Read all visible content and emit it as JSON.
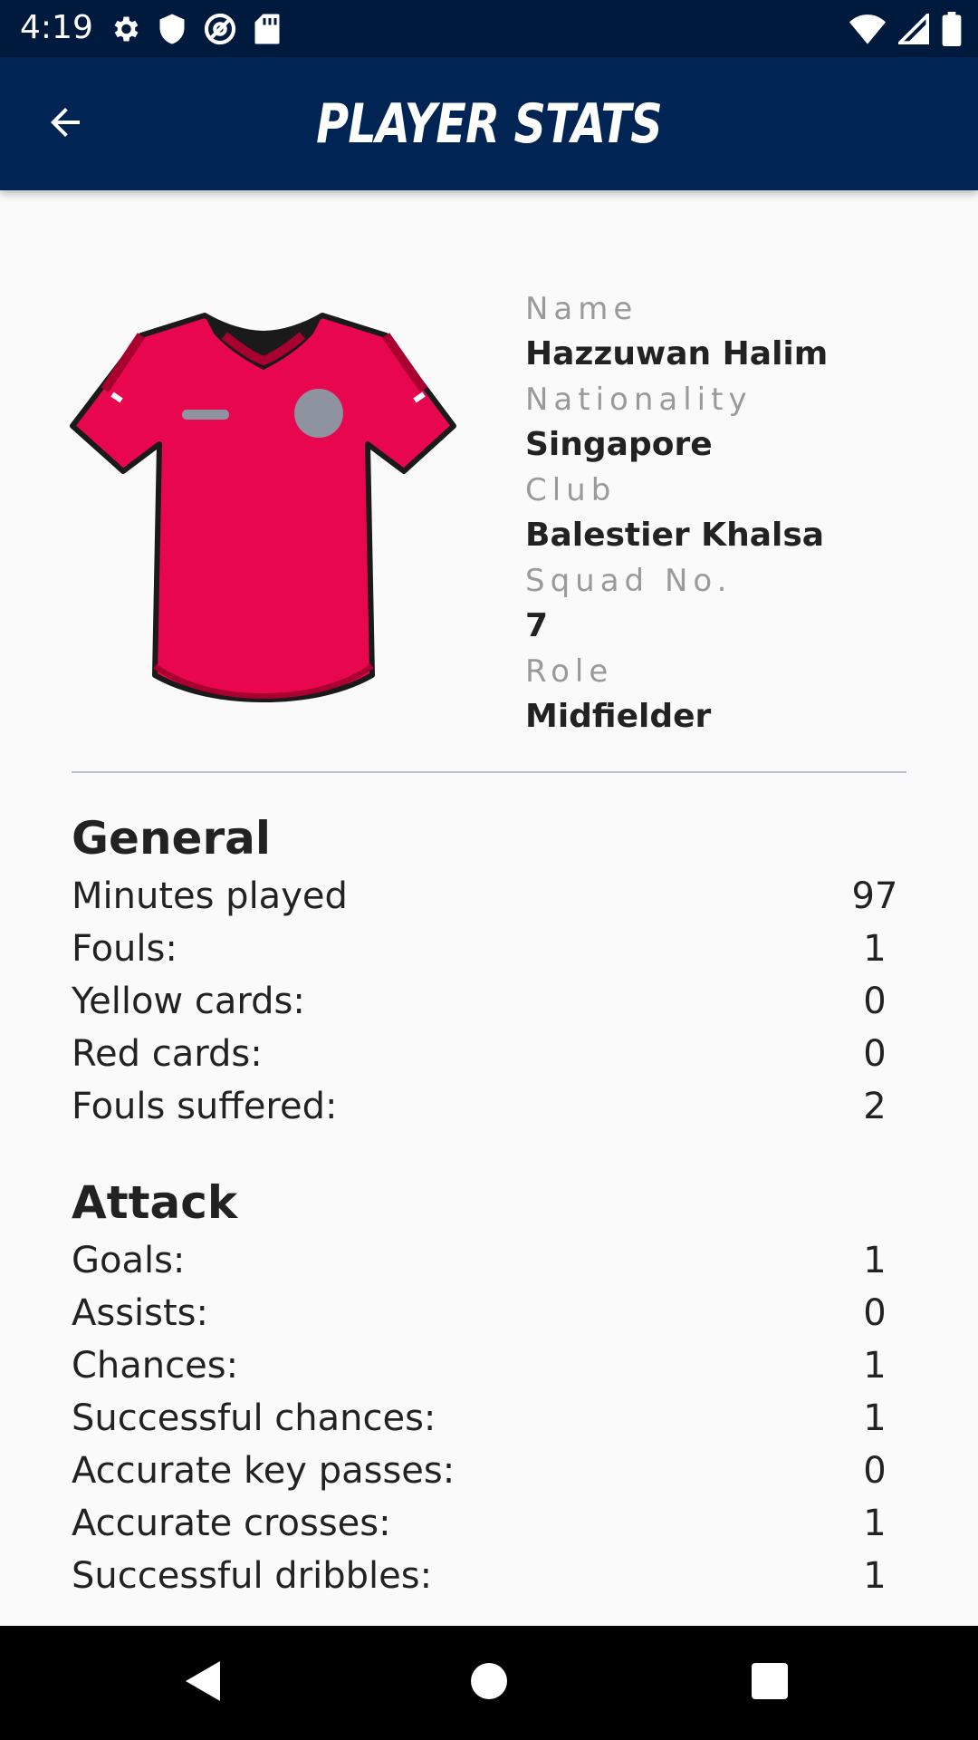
{
  "status_bar": {
    "time": "4:19",
    "left_icons": [
      "gear-icon",
      "shield-icon",
      "at-sign-icon",
      "sd-card-icon"
    ],
    "right_icons": [
      "wifi-icon",
      "signal-icon",
      "battery-icon"
    ]
  },
  "app_bar": {
    "title": "PLAYER STATS",
    "back_icon": "arrow-left-icon"
  },
  "player": {
    "jersey_colors": {
      "primary": "#e8064f",
      "collar": "#1a1a1a"
    },
    "fields": [
      {
        "label": "Name",
        "value": "Hazzuwan Halim"
      },
      {
        "label": "Nationality",
        "value": "Singapore"
      },
      {
        "label": "Club",
        "value": "Balestier Khalsa"
      },
      {
        "label": "Squad No.",
        "value": "7"
      },
      {
        "label": "Role",
        "value": "Midfielder"
      }
    ]
  },
  "sections": [
    {
      "title": "General",
      "rows": [
        {
          "label": "Minutes played",
          "value": "97"
        },
        {
          "label": "Fouls:",
          "value": "1"
        },
        {
          "label": "Yellow cards:",
          "value": "0"
        },
        {
          "label": "Red cards:",
          "value": "0"
        },
        {
          "label": "Fouls suffered:",
          "value": "2"
        }
      ]
    },
    {
      "title": "Attack",
      "rows": [
        {
          "label": "Goals:",
          "value": "1"
        },
        {
          "label": "Assists:",
          "value": "0"
        },
        {
          "label": "Chances:",
          "value": "1"
        },
        {
          "label": "Successful chances:",
          "value": "1"
        },
        {
          "label": "Accurate key passes:",
          "value": "0"
        },
        {
          "label": "Accurate crosses:",
          "value": "1"
        },
        {
          "label": "Successful dribbles:",
          "value": "1"
        }
      ]
    }
  ],
  "nav_bar": {
    "buttons": [
      "back-triangle-icon",
      "home-circle-icon",
      "recents-square-icon"
    ]
  },
  "colors": {
    "status_bar": "#001a3d",
    "app_bar": "#002554",
    "background": "#fafafa"
  }
}
